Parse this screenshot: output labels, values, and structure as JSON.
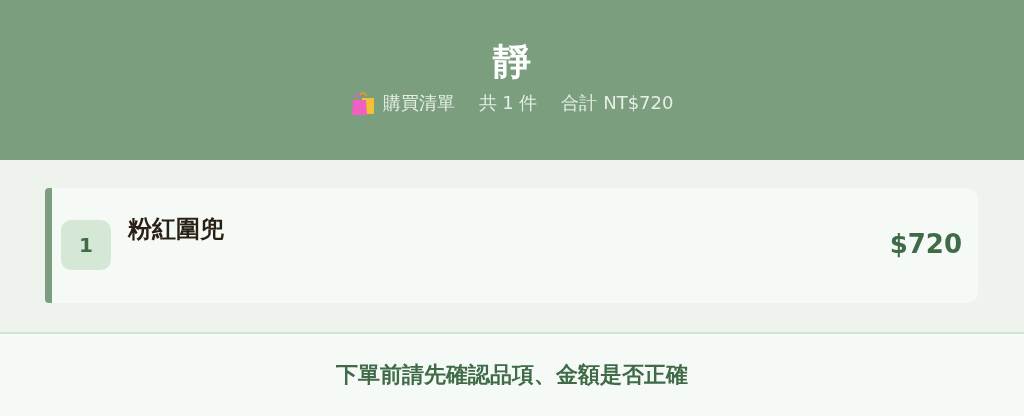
{
  "header": {
    "title": "靜",
    "list_label": "購買清單",
    "count": "共 1 件",
    "total": "合計 NT$720"
  },
  "items": [
    {
      "index": "1",
      "name": "粉紅圍兜",
      "price": "$720"
    }
  ],
  "footer": {
    "notice": "下單前請先確認品項、金額是否正確"
  }
}
